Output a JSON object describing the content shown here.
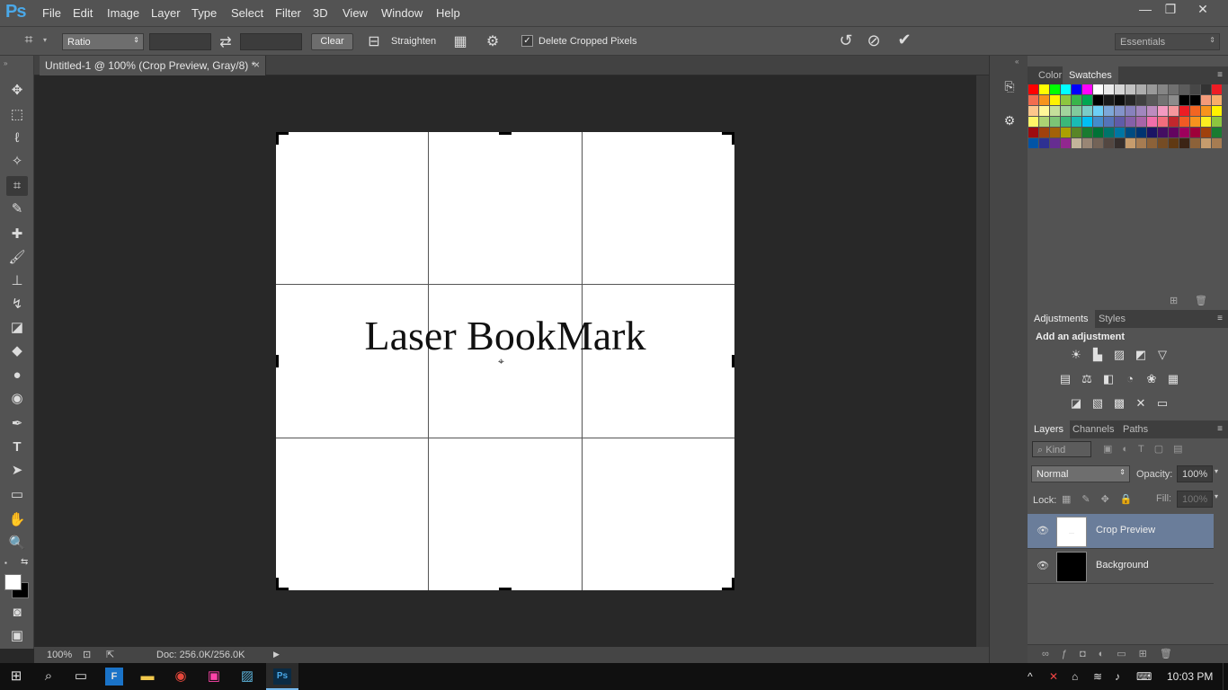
{
  "app": {
    "logo": "Ps"
  },
  "menu": [
    "File",
    "Edit",
    "Image",
    "Layer",
    "Type",
    "Select",
    "Filter",
    "3D",
    "View",
    "Window",
    "Help"
  ],
  "window_controls": {
    "minimize": "—",
    "restore": "❐",
    "close": "✕"
  },
  "options": {
    "ratio_select": "Ratio",
    "clear_label": "Clear",
    "straighten_label": "Straighten",
    "delete_cropped_label": "Delete Cropped Pixels",
    "workspace_select": "Essentials"
  },
  "document": {
    "tab_title": "Untitled-1 @ 100% (Crop Preview, Gray/8) *",
    "tab_close": "×",
    "canvas_text": "Laser BookMark"
  },
  "status": {
    "zoom": "100%",
    "doc_info": "Doc: 256.0K/256.0K"
  },
  "panels": {
    "color_tab": "Color",
    "swatches_tab": "Swatches",
    "adjustments_tab": "Adjustments",
    "styles_tab": "Styles",
    "add_adjustment": "Add an adjustment",
    "layers_tab": "Layers",
    "channels_tab": "Channels",
    "paths_tab": "Paths",
    "kind_filter": "Kind",
    "blend_mode": "Normal",
    "opacity_label": "Opacity:",
    "opacity_value": "100%",
    "lock_label": "Lock:",
    "fill_label": "Fill:",
    "fill_value": "100%"
  },
  "layers": [
    {
      "name": "Crop Preview",
      "selected": true,
      "thumb_color": "#ffffff"
    },
    {
      "name": "Background",
      "selected": false,
      "thumb_color": "#000000"
    }
  ],
  "swatches": [
    [
      "#ff0000",
      "#ffff00",
      "#00ff00",
      "#00ffff",
      "#0000ff",
      "#ff00ff",
      "#ffffff",
      "#ebebeb",
      "#d6d6d6",
      "#c2c2c2",
      "#adadad",
      "#999999",
      "#858585",
      "#707070",
      "#5c5c5c",
      "#474747",
      "#333333",
      "#ee1c24"
    ],
    [
      "#f26c4f",
      "#f7941d",
      "#fff200",
      "#8dc63f",
      "#39b54a",
      "#00a651",
      "#000000",
      "#1a1a1a",
      "#0d0d0d",
      "#262626",
      "#404040",
      "#595959",
      "#737373",
      "#8c8c8c",
      "#000000",
      "#000000",
      "#f49b7a",
      "#f7ad6a"
    ],
    [
      "#fdc68c",
      "#fff799",
      "#c4df9b",
      "#a2d39c",
      "#82ca9c",
      "#7accc8",
      "#6dcff6",
      "#7da7d9",
      "#8393ca",
      "#8781bd",
      "#a186be",
      "#bd8cbf",
      "#f49ac1",
      "#f5989d",
      "#ed1c24",
      "#f26522",
      "#f7941d",
      "#fff200"
    ],
    [
      "#fff568",
      "#acd373",
      "#7cc576",
      "#3bb878",
      "#1abbb4",
      "#00bff3",
      "#448ccb",
      "#5574b9",
      "#605ca8",
      "#8560a8",
      "#a864a8",
      "#f06eaa",
      "#f26d7d",
      "#c1272d",
      "#f15a24",
      "#f7931e",
      "#fcee21",
      "#8cc63f"
    ],
    [
      "#9e0b0f",
      "#a0410d",
      "#a36209",
      "#aba000",
      "#598527",
      "#1a7b30",
      "#007236",
      "#00746b",
      "#0076a3",
      "#004b80",
      "#003471",
      "#1b1464",
      "#440e62",
      "#630460",
      "#9e005d",
      "#9e0039",
      "#a0410d",
      "#197b30"
    ],
    [
      "#0054a6",
      "#2e3192",
      "#662d91",
      "#92278f",
      "#c2b49a",
      "#998675",
      "#736357",
      "#534741",
      "#362f2d",
      "#c69c6d",
      "#a67c52",
      "#8c6239",
      "#754c24",
      "#603913",
      "#3c2415",
      "#8c6239",
      "#c69c6d",
      "#a67c52"
    ]
  ],
  "taskbar": {
    "time": "10:03 PM"
  },
  "tools": [
    "move",
    "marquee",
    "lasso",
    "magic-wand",
    "crop",
    "eyedropper",
    "healing",
    "brush",
    "stamp",
    "history-brush",
    "eraser",
    "paint-bucket",
    "blur",
    "dodge",
    "pen",
    "type",
    "path-select",
    "rectangle",
    "hand",
    "zoom"
  ]
}
